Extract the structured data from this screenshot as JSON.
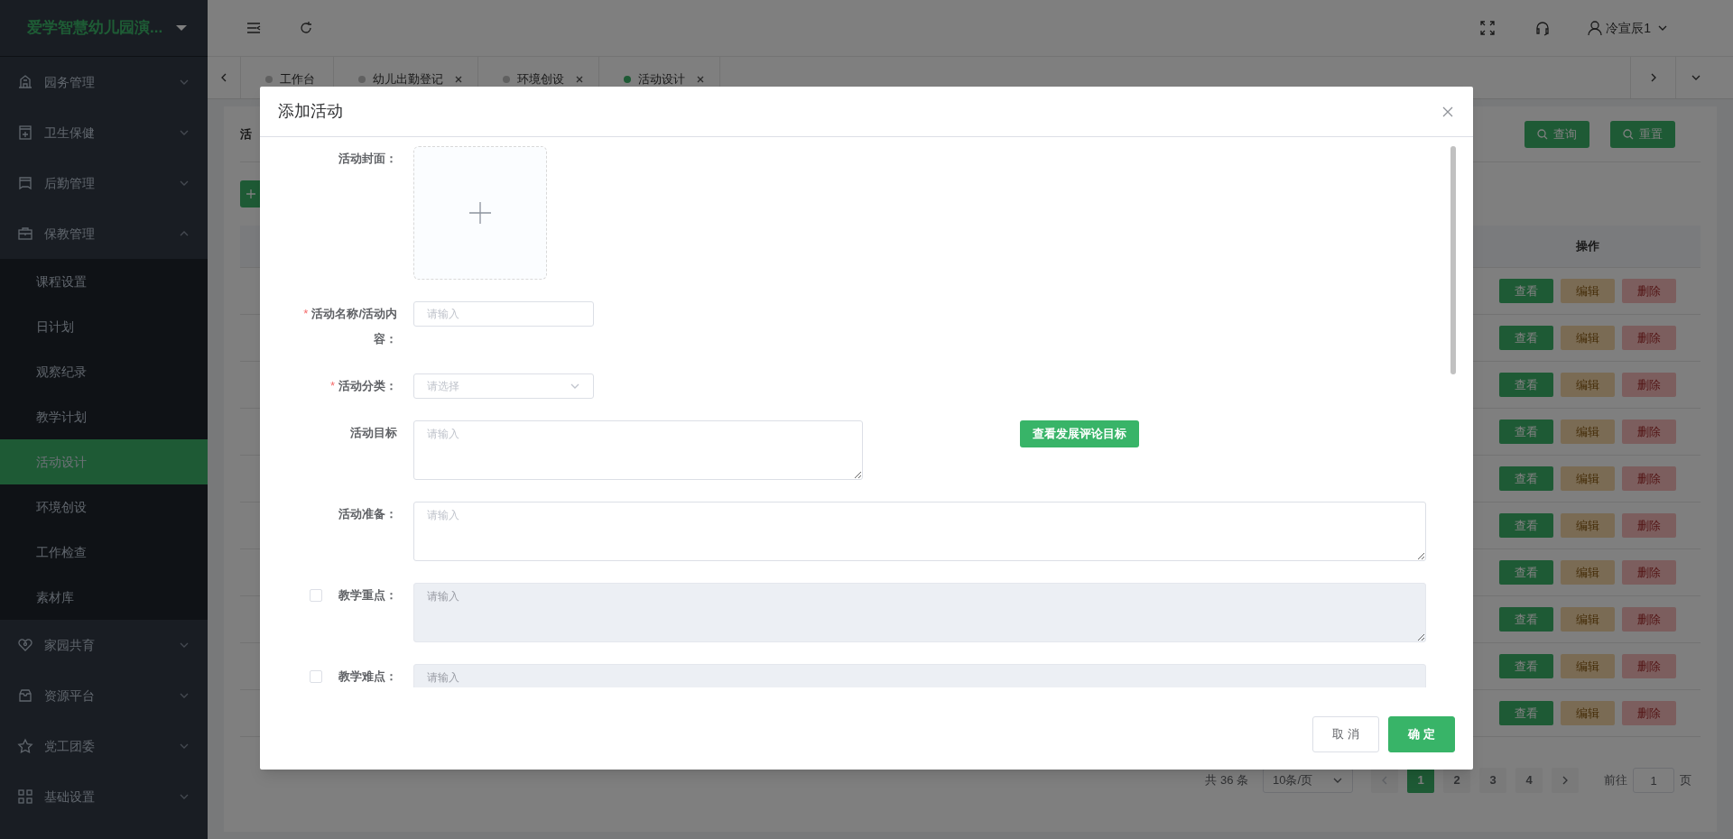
{
  "sidebar": {
    "logo": "爱学智慧幼儿园演...",
    "items": [
      {
        "label": "园务管理",
        "expanded": false
      },
      {
        "label": "卫生保健",
        "expanded": false
      },
      {
        "label": "后勤管理",
        "expanded": false
      },
      {
        "label": "保教管理",
        "expanded": true,
        "children": [
          {
            "label": "课程设置",
            "selected": false
          },
          {
            "label": "日计划",
            "selected": false
          },
          {
            "label": "观察纪录",
            "selected": false
          },
          {
            "label": "教学计划",
            "selected": false
          },
          {
            "label": "活动设计",
            "selected": true
          },
          {
            "label": "环境创设",
            "selected": false
          },
          {
            "label": "工作检查",
            "selected": false
          },
          {
            "label": "素材库",
            "selected": false
          }
        ]
      },
      {
        "label": "家园共育",
        "expanded": false
      },
      {
        "label": "资源平台",
        "expanded": false
      },
      {
        "label": "党工团委",
        "expanded": false
      },
      {
        "label": "基础设置",
        "expanded": false
      }
    ]
  },
  "header": {
    "user": "冷宣辰1"
  },
  "tabs": [
    {
      "label": "工作台",
      "selected": false,
      "closable": false
    },
    {
      "label": "幼儿出勤登记",
      "selected": false,
      "closable": true
    },
    {
      "label": "环境创设",
      "selected": false,
      "closable": true
    },
    {
      "label": "活动设计",
      "selected": true,
      "closable": true
    }
  ],
  "page": {
    "filter_label": "活",
    "search_buttons": [
      "查询",
      "重置"
    ],
    "table": {
      "columns": [
        "操作"
      ],
      "rows": [
        {
          "actions": [
            "查看",
            "编辑",
            "删除"
          ]
        },
        {
          "actions": [
            "查看",
            "编辑",
            "删除"
          ]
        },
        {
          "actions": [
            "查看",
            "编辑",
            "删除"
          ]
        },
        {
          "actions": [
            "查看",
            "编辑",
            "删除"
          ]
        },
        {
          "actions": [
            "查看",
            "编辑",
            "删除"
          ]
        },
        {
          "actions": [
            "查看",
            "编辑",
            "删除"
          ]
        },
        {
          "actions": [
            "查看",
            "编辑",
            "删除"
          ]
        },
        {
          "actions": [
            "查看",
            "编辑",
            "删除"
          ]
        },
        {
          "actions": [
            "查看",
            "编辑",
            "删除"
          ]
        },
        {
          "actions": [
            "查看",
            "编辑",
            "删除"
          ]
        }
      ]
    },
    "pagination": {
      "total": "共 36 条",
      "page_size": "10条/页",
      "pages": [
        {
          "label": "1",
          "selected": true
        },
        {
          "label": "2",
          "selected": false
        },
        {
          "label": "3",
          "selected": false
        },
        {
          "label": "4",
          "selected": false
        }
      ],
      "goto_label": "前往",
      "goto_value": "1",
      "goto_suffix": "页"
    }
  },
  "dialog": {
    "title": "添加活动",
    "fields": [
      {
        "kind": "upload",
        "label": "活动封面："
      },
      {
        "kind": "input",
        "label": "活动名称/活动内容：",
        "required_mark": "*",
        "placeholder": "请输入"
      },
      {
        "kind": "select",
        "label": "活动分类：",
        "required_mark": "*",
        "placeholder": "请选择"
      },
      {
        "kind": "textarea",
        "label": "活动目标",
        "placeholder": "请输入",
        "disabled": false,
        "action": "查看发展评论目标"
      },
      {
        "kind": "textarea",
        "label": "活动准备：",
        "placeholder": "请输入",
        "disabled": false
      },
      {
        "kind": "textarea",
        "label": "教学重点：",
        "placeholder": "请输入",
        "disabled": true,
        "checkbox": {
          "checked": false
        }
      },
      {
        "kind": "textarea",
        "label": "教学难点：",
        "placeholder": "请输入",
        "disabled": true,
        "checkbox": {
          "checked": false
        }
      }
    ],
    "buttons": [
      {
        "label": "取 消",
        "kind": "default"
      },
      {
        "label": "确 定",
        "kind": "primary"
      }
    ]
  }
}
